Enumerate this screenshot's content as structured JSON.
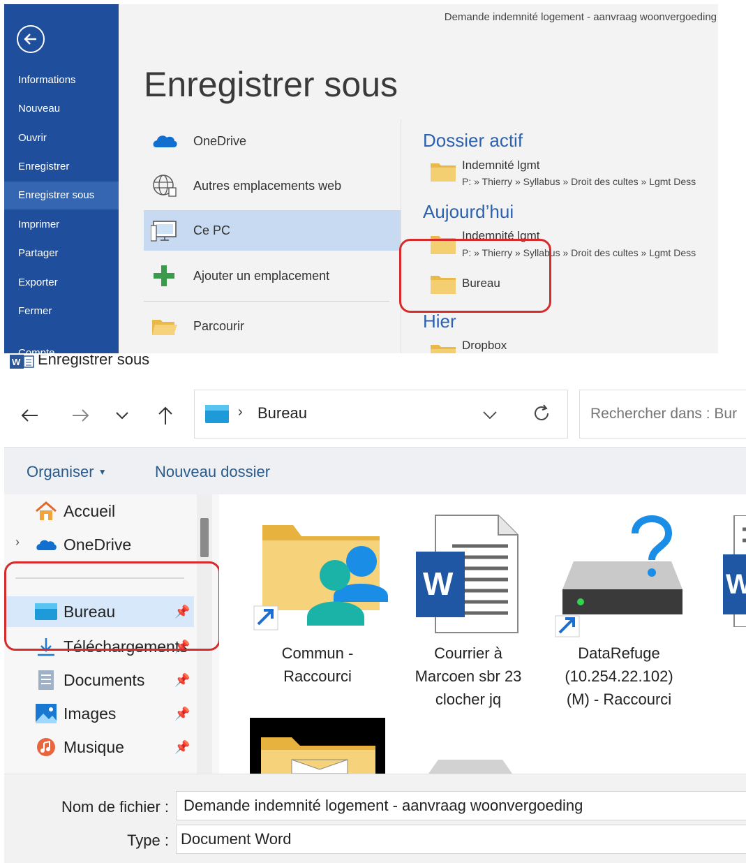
{
  "backstage": {
    "nav": {
      "items": [
        "Informations",
        "Nouveau",
        "Ouvrir",
        "Enregistrer",
        "Enregistrer sous",
        "Imprimer",
        "Partager",
        "Exporter",
        "Fermer",
        "Compte"
      ],
      "active_index": 4
    },
    "doc_title": "Demande indemnité logement - aanvraag woonvergoeding",
    "heading": "Enregistrer sous",
    "locations": [
      {
        "label": "OneDrive",
        "icon": "onedrive-cloud-icon"
      },
      {
        "label": "Autres emplacements web",
        "icon": "globe-icon"
      },
      {
        "label": "Ce PC",
        "icon": "computer-icon",
        "selected": true
      },
      {
        "label": "Ajouter un emplacement",
        "icon": "add-plus-icon"
      },
      {
        "label": "Parcourir",
        "icon": "open-folder-icon"
      }
    ],
    "sections": {
      "dossier_actif": {
        "title": "Dossier actif",
        "items": [
          {
            "name": "Indemnité lgmt",
            "path": "P: » Thierry » Syllabus » Droit des cultes » Lgmt Dess"
          }
        ]
      },
      "aujourdhui": {
        "title": "Aujourd’hui",
        "items": [
          {
            "name": "Indemnité lgmt",
            "path": "P: » Thierry » Syllabus » Droit des cultes » Lgmt Dess"
          },
          {
            "name": "Bureau",
            "path": ""
          }
        ]
      },
      "hier": {
        "title": "Hier",
        "items": [
          {
            "name": "Dropbox",
            "path": ""
          }
        ]
      }
    },
    "colors": {
      "nav_bg": "#1f4f9c",
      "nav_active": "#3466b1",
      "section_title": "#2b62b0",
      "highlight_box": "#d72b2b"
    }
  },
  "dialog": {
    "title": "Enregistrer sous",
    "address": {
      "crumb": "Bureau"
    },
    "search": {
      "placeholder": "Rechercher dans : Bur"
    },
    "commands": {
      "organize": "Organiser",
      "new_folder": "Nouveau dossier"
    },
    "tree": [
      {
        "label": "Accueil",
        "icon": "home-icon"
      },
      {
        "label": "OneDrive",
        "icon": "onedrive-cloud-icon",
        "expandable": true
      },
      {
        "label": "Bureau",
        "icon": "desktop-icon",
        "pinned": true,
        "selected": true
      },
      {
        "label": "Téléchargements",
        "icon": "download-icon",
        "pinned": true
      },
      {
        "label": "Documents",
        "icon": "documents-icon",
        "pinned": true
      },
      {
        "label": "Images",
        "icon": "images-icon",
        "pinned": true
      },
      {
        "label": "Musique",
        "icon": "music-icon",
        "pinned": true
      }
    ],
    "files": [
      {
        "name": "Commun - Raccourci",
        "icon": "shared-folder-shortcut-icon"
      },
      {
        "name": "Courrier à Marcoen sbr 23 clocher jq",
        "icon": "word-document-icon"
      },
      {
        "name": "DataRefuge (10.254.22.102) (M) - Raccourci",
        "icon": "network-drive-shortcut-icon"
      }
    ],
    "filename_label": "Nom de fichier :",
    "filename_value": "Demande indemnité logement - aanvraag woonvergoeding",
    "type_label": "Type :",
    "type_value": "Document Word"
  }
}
